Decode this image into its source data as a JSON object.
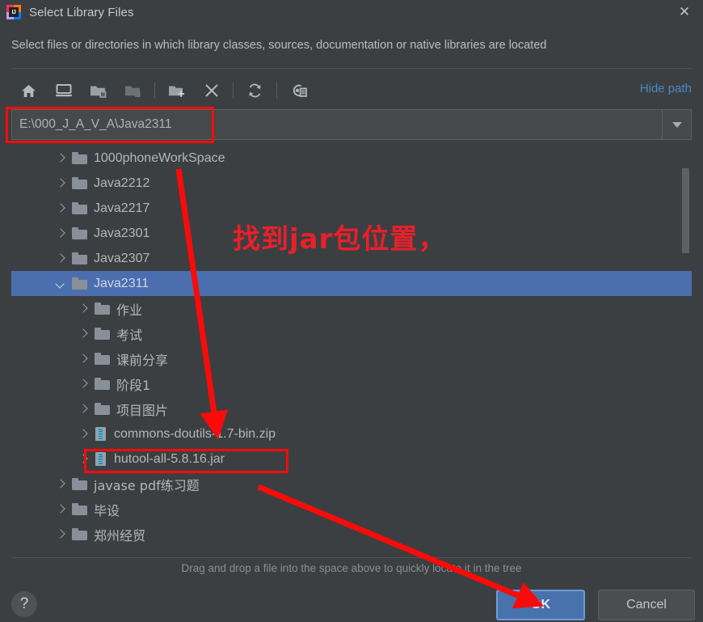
{
  "window": {
    "title": "Select Library Files",
    "app_icon": "intellij-idea-logo",
    "close_label": "✕"
  },
  "description": "Select files or directories in which library classes, sources, documentation or native libraries are located",
  "toolbar": {
    "buttons": [
      {
        "name": "home-icon",
        "tooltip": "Home"
      },
      {
        "name": "desktop-icon",
        "tooltip": "Desktop"
      },
      {
        "name": "project-folder-icon",
        "tooltip": "Project Directory"
      },
      {
        "name": "module-folder-icon",
        "tooltip": "Module Directory"
      },
      {
        "name": "new-folder-icon",
        "tooltip": "New Folder"
      },
      {
        "name": "delete-icon",
        "tooltip": "Delete"
      },
      {
        "name": "refresh-icon",
        "tooltip": "Refresh"
      },
      {
        "name": "show-hidden-files-icon",
        "tooltip": "Show Hidden Files"
      }
    ],
    "hide_path_label": "Hide path"
  },
  "path_field": {
    "value": "E:\\000_J_A_V_A\\Java2311",
    "placeholder": "",
    "dropdown_icon": "chevron-down-icon"
  },
  "tree": {
    "rows": [
      {
        "label": "1000phoneWorkSpace",
        "icon": "folder-icon",
        "indent": 0,
        "expanded": false,
        "selected": false,
        "cjk": false
      },
      {
        "label": "Java2212",
        "icon": "folder-icon",
        "indent": 0,
        "expanded": false,
        "selected": false,
        "cjk": false
      },
      {
        "label": "Java2217",
        "icon": "folder-icon",
        "indent": 0,
        "expanded": false,
        "selected": false,
        "cjk": false
      },
      {
        "label": "Java2301",
        "icon": "folder-icon",
        "indent": 0,
        "expanded": false,
        "selected": false,
        "cjk": false
      },
      {
        "label": "Java2307",
        "icon": "folder-icon",
        "indent": 0,
        "expanded": false,
        "selected": false,
        "cjk": false
      },
      {
        "label": "Java2311",
        "icon": "folder-icon",
        "indent": 0,
        "expanded": true,
        "selected": true,
        "cjk": false
      },
      {
        "label": "作业",
        "icon": "folder-icon",
        "indent": 1,
        "expanded": false,
        "selected": false,
        "cjk": true
      },
      {
        "label": "考试",
        "icon": "folder-icon",
        "indent": 1,
        "expanded": false,
        "selected": false,
        "cjk": true
      },
      {
        "label": "课前分享",
        "icon": "folder-icon",
        "indent": 1,
        "expanded": false,
        "selected": false,
        "cjk": true
      },
      {
        "label": "阶段1",
        "icon": "folder-icon",
        "indent": 1,
        "expanded": false,
        "selected": false,
        "cjk": true
      },
      {
        "label": "项目图片",
        "icon": "folder-icon",
        "indent": 1,
        "expanded": false,
        "selected": false,
        "cjk": true
      },
      {
        "label": "commons-doutils-1.7-bin.zip",
        "icon": "archive-icon",
        "indent": 1,
        "expanded": false,
        "selected": false,
        "cjk": false
      },
      {
        "label": "hutool-all-5.8.16.jar",
        "icon": "archive-icon",
        "indent": 1,
        "expanded": false,
        "selected": false,
        "cjk": false
      },
      {
        "label": "javase pdf练习题",
        "icon": "folder-icon",
        "indent": 0,
        "expanded": false,
        "selected": false,
        "cjk": true
      },
      {
        "label": "毕设",
        "icon": "folder-icon",
        "indent": 0,
        "expanded": false,
        "selected": false,
        "cjk": true
      },
      {
        "label": "郑州经贸",
        "icon": "folder-icon",
        "indent": 0,
        "expanded": false,
        "selected": false,
        "cjk": true
      }
    ],
    "scrollbar": {
      "name": "vertical-scrollbar"
    }
  },
  "hint": "Drag and drop a file into the space above to quickly locate it in the tree",
  "footer": {
    "help_label": "?",
    "ok_label": "OK",
    "cancel_label": "Cancel"
  },
  "annotations": {
    "note_text": "找到jar包位置，",
    "note_color": "#e8202a",
    "box_color": "#fb0a0a"
  },
  "colors": {
    "background": "#3c3f41",
    "selection": "#4b6eaf",
    "link": "#4a88c7",
    "ok_button": "#4872ab",
    "text": "#b4b7b4"
  }
}
